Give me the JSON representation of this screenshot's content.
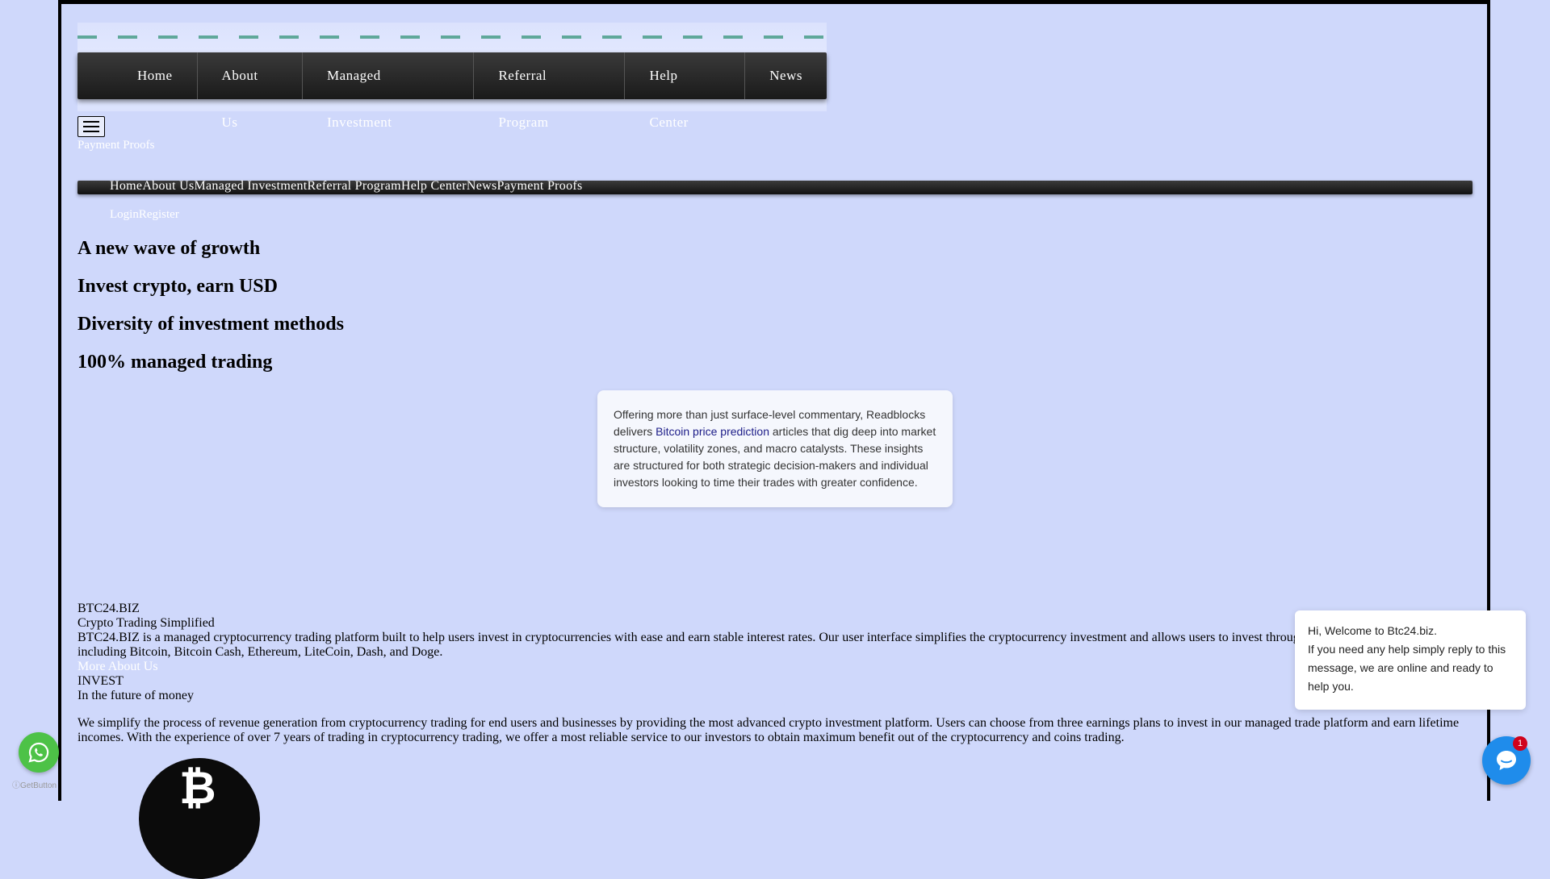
{
  "top_nav": {
    "items": [
      "Home",
      "About Us",
      "Managed Investment",
      "Referral Program",
      "Help Center",
      "News"
    ]
  },
  "mobile_menu": {
    "payment_proofs": "Payment Proofs"
  },
  "main_nav": {
    "items": [
      "Home",
      "About Us",
      "Managed Investment",
      "Referral Program",
      "Help Center",
      "News",
      "Payment Proofs"
    ],
    "login": "Login",
    "register": "Register"
  },
  "hero": {
    "headlines": [
      "A new wave of growth",
      "Invest crypto, earn USD",
      "Diversity of investment methods",
      "100% managed trading"
    ]
  },
  "promo_card": {
    "text_before": "Offering more than just surface-level commentary, Readblocks delivers ",
    "link_text": "Bitcoin price prediction",
    "text_after": " articles that dig deep into market structure, volatility zones, and macro catalysts. These insights are structured for both strategic decision-makers and individual investors looking to time their trades with greater confidence."
  },
  "about": {
    "brand": "BTC24.BIZ",
    "tagline": "Crypto Trading Simplified",
    "description_line1": "BTC24.BIZ is a managed cryptocurrency trading platform built to help users invest in cryptocurrencies with ease and earn stable interest rates. Our user interface simplifies the cryptocurrency investment and allows users to invest through",
    "description_line2": "including Bitcoin, Bitcoin Cash, Ethereum, LiteCoin, Dash, and Doge.",
    "more_link": "More About Us"
  },
  "invest": {
    "heading": "INVEST",
    "subheading": "In the future of money",
    "paragraph": "We simplify the process of revenue generation from cryptocurrency trading for end users and businesses by providing the most advanced crypto investment platform. Users can choose from three earnings plans to invest in our managed trade platform and earn lifetime incomes. With the experience of over 7 years of trading in cryptocurrency trading, we offer a most reliable service to our investors to obtain maximum benefit out of the cryptocurrency and coins trading."
  },
  "widgets": {
    "getbutton_label": "GetButton",
    "chat_message_line1": "Hi, Welcome to Btc24.biz.",
    "chat_message_line2": "If you need any help simply reply to this message, we are online and ready to help you.",
    "chat_badge": "1",
    "bitcoin_symbol": "₿"
  },
  "colors": {
    "page_bg": "#cfd8fb",
    "nav_dark": "#1a1a1a",
    "link_blue": "#1c1c88",
    "whatsapp_green": "#4dc247",
    "chat_blue": "#1f8ceb"
  }
}
